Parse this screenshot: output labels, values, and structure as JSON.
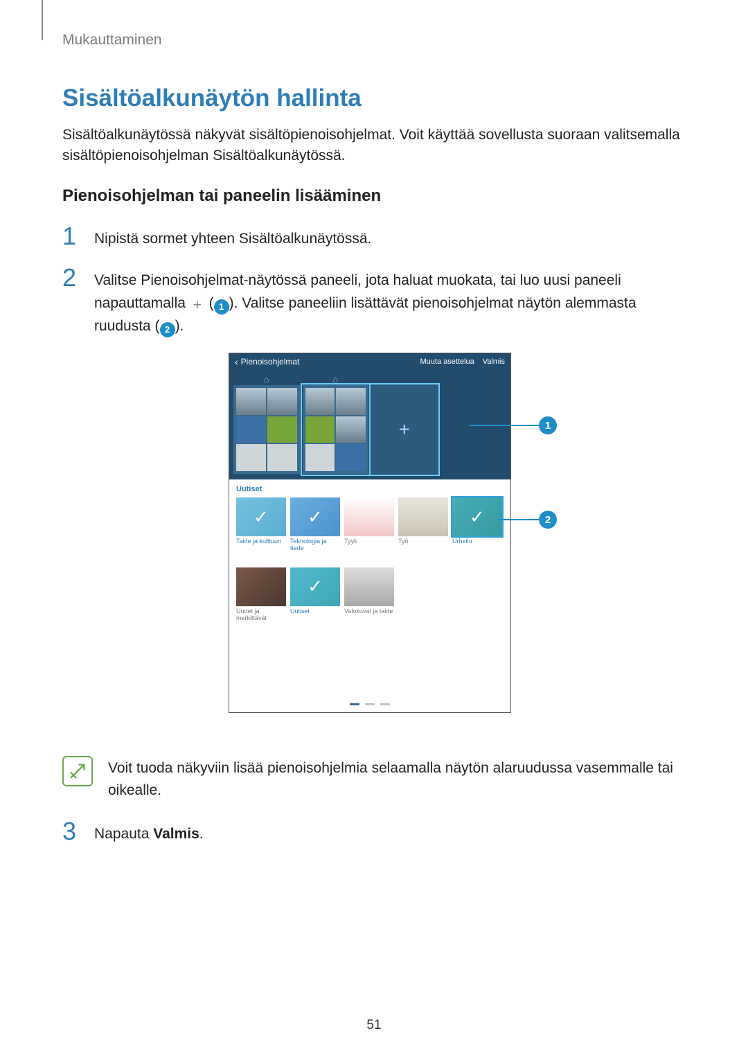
{
  "breadcrumb": "Mukauttaminen",
  "title": "Sisältöalkunäytön hallinta",
  "lead": "Sisältöalkunäytössä näkyvät sisältöpienoisohjelmat. Voit käyttää sovellusta suoraan valitsemalla sisältöpienoisohjelman Sisältöalkunäytössä.",
  "sub_heading": "Pienoisohjelman tai paneelin lisääminen",
  "steps": {
    "s1": {
      "num": "1",
      "text": "Nipistä sormet yhteen Sisältöalkunäytössä."
    },
    "s2": {
      "num": "2",
      "part_a": "Valitse Pienoisohjelmat-näytössä paneeli, jota haluat muokata, tai luo uusi paneeli napauttamalla ",
      "plus": "+",
      "open_paren": " (",
      "badge1": "1",
      "mid": "). Valitse paneeliin lisättävät pienoisohjelmat näytön alemmasta ruudusta (",
      "badge2": "2",
      "close_paren": ")."
    },
    "s3": {
      "num": "3",
      "pre": "Napauta ",
      "bold": "Valmis",
      "post": "."
    }
  },
  "screenshot": {
    "back_label": "Pienoisohjelmat",
    "action_left": "Muuta asettelua",
    "action_right": "Valmis",
    "plus_panel": "+",
    "cat_news": "Uutiset",
    "tiles_row1": [
      {
        "label": "Taide ja kulttuuri",
        "style": "blue"
      },
      {
        "label": "Teknologia ja tiede",
        "style": "blue"
      },
      {
        "label": "Tyyli",
        "style": "muted"
      },
      {
        "label": "Työ",
        "style": "muted"
      },
      {
        "label": "Urheilu",
        "style": "blue"
      }
    ],
    "tiles_row2": [
      {
        "label": "Uudet ja merkittävät",
        "style": "muted"
      },
      {
        "label": "Uutiset",
        "style": "blue"
      },
      {
        "label": "Valokuvat ja taide",
        "style": "muted"
      }
    ],
    "callouts": {
      "c1": "1",
      "c2": "2"
    }
  },
  "note": "Voit tuoda näkyviin lisää pienoisohjelmia selaamalla näytön alaruudussa vasemmalle tai oikealle.",
  "page_number": "51"
}
